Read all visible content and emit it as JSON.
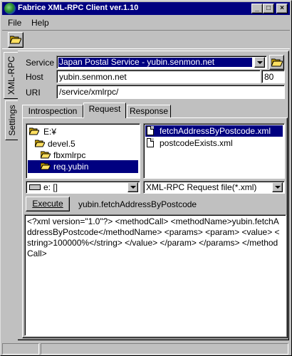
{
  "window": {
    "title": "Fabrice XML-RPC Client ver.1.10",
    "controls": {
      "minimize": "_",
      "maximize": "□",
      "close": "×"
    }
  },
  "menu": {
    "file": "File",
    "help": "Help"
  },
  "toolbar": {
    "open_icon": "folder-open-icon"
  },
  "side_tabs": {
    "xmlrpc": "XML-RPC",
    "settings": "Settings"
  },
  "form": {
    "service_label": "Service",
    "service_value": "Japan Postal Service - yubin.senmon.net",
    "host_label": "Host",
    "host_value": "yubin.senmon.net",
    "port_value": "80",
    "uri_label": "URI",
    "uri_value": "/service/xmlrpc/"
  },
  "tabs": {
    "introspection": "Introspection",
    "request": "Request",
    "response": "Response"
  },
  "folders": [
    {
      "label": "E:¥"
    },
    {
      "label": "devel.5"
    },
    {
      "label": "fbxmlrpc"
    },
    {
      "label": "req.yubin"
    }
  ],
  "files": [
    {
      "label": "fetchAddressByPostcode.xml"
    },
    {
      "label": "postcodeExists.xml"
    }
  ],
  "drive_select": "e: []",
  "filter_select": "XML-RPC Request file(*.xml)",
  "execute_label": "Execute",
  "current_method": "yubin.fetchAddressByPostcode",
  "request_body": "<?xml version=\"1.0\"?> <methodCall> <methodName>yubin.fetchAddressByPostcode</methodName> <params> <param> <value> <string>100000%</string> </value> </param> </params> </methodCall>",
  "colors": {
    "titlebar": "#000080",
    "selection": "#000080",
    "face": "#c0c0c0"
  }
}
